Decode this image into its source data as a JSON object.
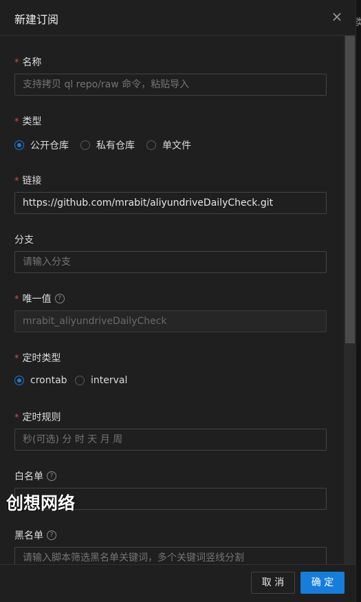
{
  "background": {
    "partial_text": "类"
  },
  "modal": {
    "title": "新建订阅",
    "close_symbol": "×"
  },
  "form": {
    "required_mark": "*",
    "help_symbol": "?",
    "name": {
      "label": "名称",
      "placeholder": "支持拷贝 ql repo/raw 命令，粘贴导入"
    },
    "type": {
      "label": "类型",
      "options": [
        "公开仓库",
        "私有仓库",
        "单文件"
      ],
      "selected": "公开仓库"
    },
    "link": {
      "label": "链接",
      "value": "https://github.com/mrabit/aliyundriveDailyCheck.git"
    },
    "branch": {
      "label": "分支",
      "placeholder": "请输入分支"
    },
    "alias": {
      "label": "唯一值",
      "value": "mrabit_aliyundriveDailyCheck"
    },
    "schedule_type": {
      "label": "定时类型",
      "options": [
        "crontab",
        "interval"
      ],
      "selected": "crontab"
    },
    "schedule": {
      "label": "定时规则",
      "placeholder": "秒(可选) 分 时 天 月 周"
    },
    "whitelist": {
      "label": "白名单",
      "placeholder": ""
    },
    "blacklist": {
      "label": "黑名单",
      "placeholder": "请输入脚本筛选黑名单关键词，多个关键词竖线分割"
    }
  },
  "watermark": "创想网络",
  "footer": {
    "cancel_label": "取 消",
    "ok_label": "确 定"
  },
  "colors": {
    "primary": "#177ddc",
    "required": "#d84a4a",
    "background": "#1f1f1f"
  }
}
